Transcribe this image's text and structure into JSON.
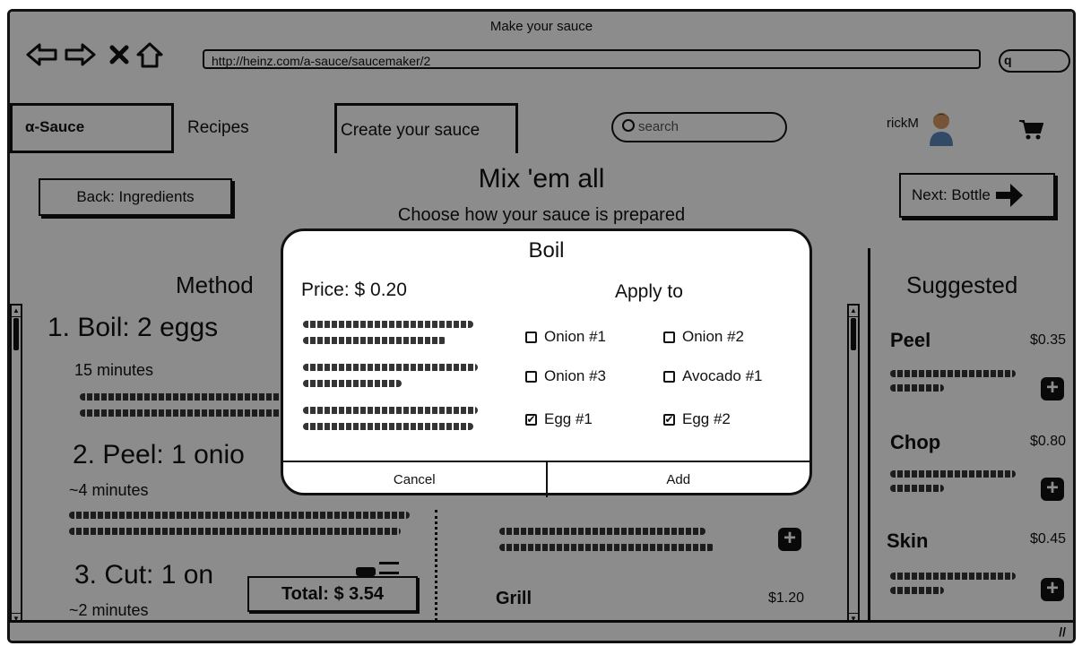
{
  "window": {
    "title": "Make your sauce",
    "url": "http://heinz.com/a-sauce/saucemaker/2",
    "search_btn": "q"
  },
  "menu": {
    "brand": "α-Sauce",
    "recipes": "Recipes",
    "create": "Create your sauce",
    "search_placeholder": "search",
    "user": "rickM"
  },
  "page": {
    "back": "Back: Ingredients",
    "next": "Next: Bottle",
    "title": "Mix 'em all",
    "subtitle": "Choose how your sauce is prepared",
    "method_title": "Method",
    "suggested_title": "Suggested",
    "steps": [
      {
        "label": "1. Boil: 2 eggs",
        "time": "15 minutes"
      },
      {
        "label": "2. Peel: 1 onio",
        "time": "~4 minutes"
      },
      {
        "label": "3. Cut: 1 on",
        "time": "~2 minutes"
      }
    ],
    "total": "Total: $ 3.54",
    "grill": {
      "name": "Grill",
      "price": "$1.20"
    },
    "suggested": [
      {
        "name": "Peel",
        "price": "$0.35"
      },
      {
        "name": "Chop",
        "price": "$0.80"
      },
      {
        "name": "Skin",
        "price": "$0.45"
      }
    ]
  },
  "modal": {
    "title": "Boil",
    "price": "Price: $ 0.20",
    "apply_to": "Apply to",
    "options": [
      {
        "label": "Onion #1",
        "checked": false
      },
      {
        "label": "Onion #2",
        "checked": false
      },
      {
        "label": "Onion #3",
        "checked": false
      },
      {
        "label": "Avocado #1",
        "checked": false
      },
      {
        "label": "Egg #1",
        "checked": true
      },
      {
        "label": "Egg #2",
        "checked": true
      }
    ],
    "cancel": "Cancel",
    "add": "Add"
  }
}
